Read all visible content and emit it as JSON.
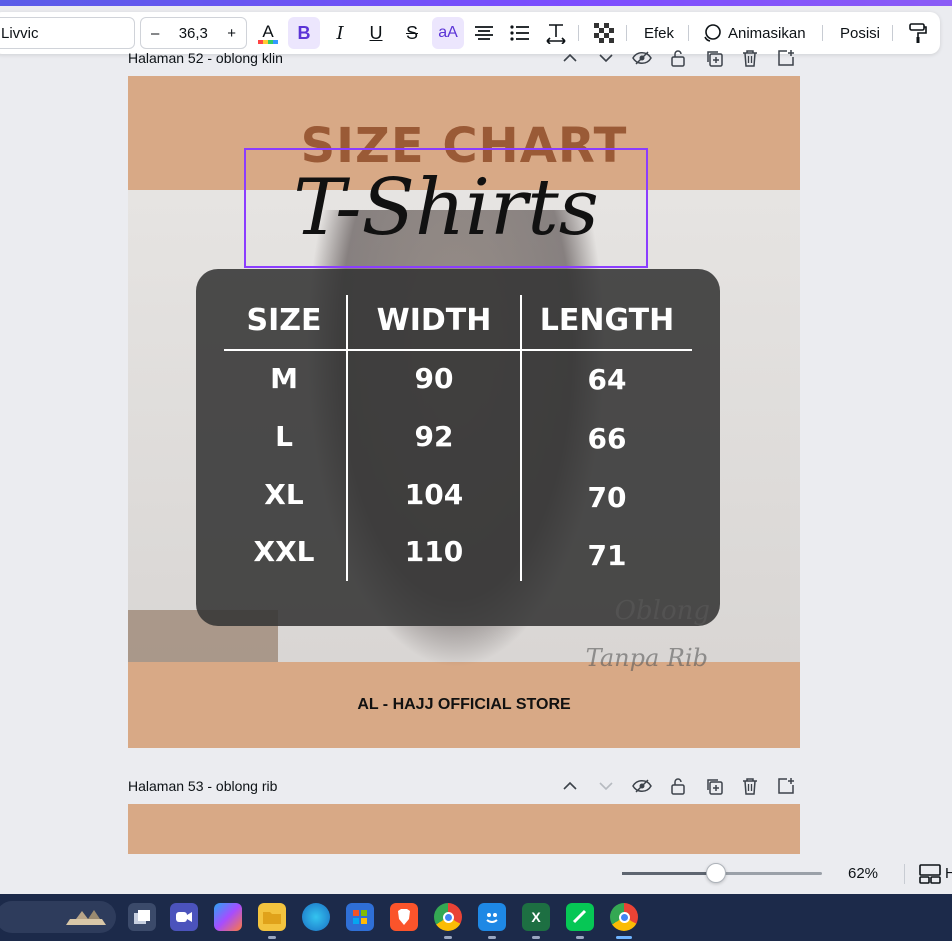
{
  "toolbar": {
    "font_name": "Livvic",
    "font_size": "36,3",
    "decrease_label": "–",
    "increase_label": "+",
    "effects_label": "Efek",
    "animate_label": "Animasikan",
    "position_label": "Posisi"
  },
  "page52": {
    "label": "Halaman 52 - oblong klin",
    "size_chart_title": "SIZE CHART",
    "script_title": "T-Shirts",
    "table": {
      "headers": [
        "SIZE",
        "WIDTH",
        "LENGTH"
      ],
      "rows": [
        [
          "M",
          "90",
          "64"
        ],
        [
          "L",
          "92",
          "66"
        ],
        [
          "XL",
          "104",
          "70"
        ],
        [
          "XXL",
          "110",
          "71"
        ]
      ]
    },
    "photo_text_1": "Oblong",
    "photo_text_2": "Tanpa Rib",
    "footer": "AL - HAJJ OFFICIAL STORE"
  },
  "page53": {
    "label": "Halaman 53 - oblong rib"
  },
  "zoom": {
    "value_text": "62%",
    "level_fraction": 0.47,
    "pages_label": "H"
  },
  "colors": {
    "accent": "#8b3dff",
    "page_bg": "#d8a986",
    "title_brown": "#9a5a36",
    "taskbar": "#1c2a4a"
  },
  "taskbar_apps": [
    "widgets-icon",
    "task-view-icon",
    "teams-icon",
    "copilot-icon",
    "file-explorer-icon",
    "edge-icon",
    "store-icon",
    "brave-icon",
    "chrome-profile-icon",
    "finder-icon",
    "excel-icon",
    "line-icon",
    "chrome-icon"
  ]
}
